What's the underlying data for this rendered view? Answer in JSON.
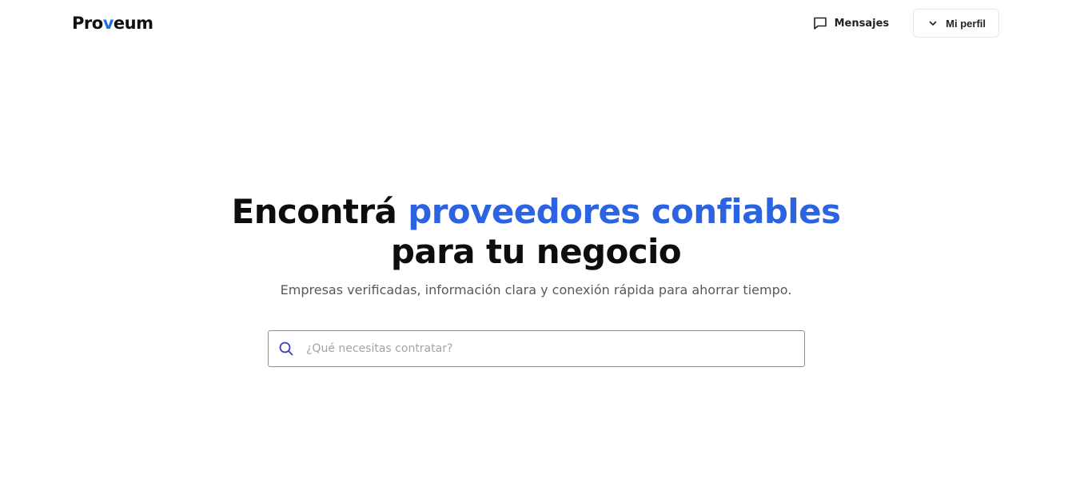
{
  "brand": {
    "logo_pre": "Pro",
    "logo_accent": "v",
    "logo_post": "eum",
    "accent_color": "#1e6fd9"
  },
  "nav": {
    "messages_label": "Mensajes",
    "messages_icon": "chat-bubble-icon",
    "profile_label": "Mi perfil",
    "profile_icon": "chevron-down-icon"
  },
  "hero": {
    "headline_part1": "Encontrá",
    "headline_highlight": "proveedores confiables",
    "headline_part2": "para tu negocio",
    "highlight_color": "#2b63e0",
    "subtitle": "Empresas verificadas, información clara y conexión rápida para ahorrar tiempo."
  },
  "search": {
    "placeholder": "¿Qué necesitas contratar?",
    "value": "",
    "icon": "search-icon",
    "icon_color": "#3b3fc4"
  }
}
